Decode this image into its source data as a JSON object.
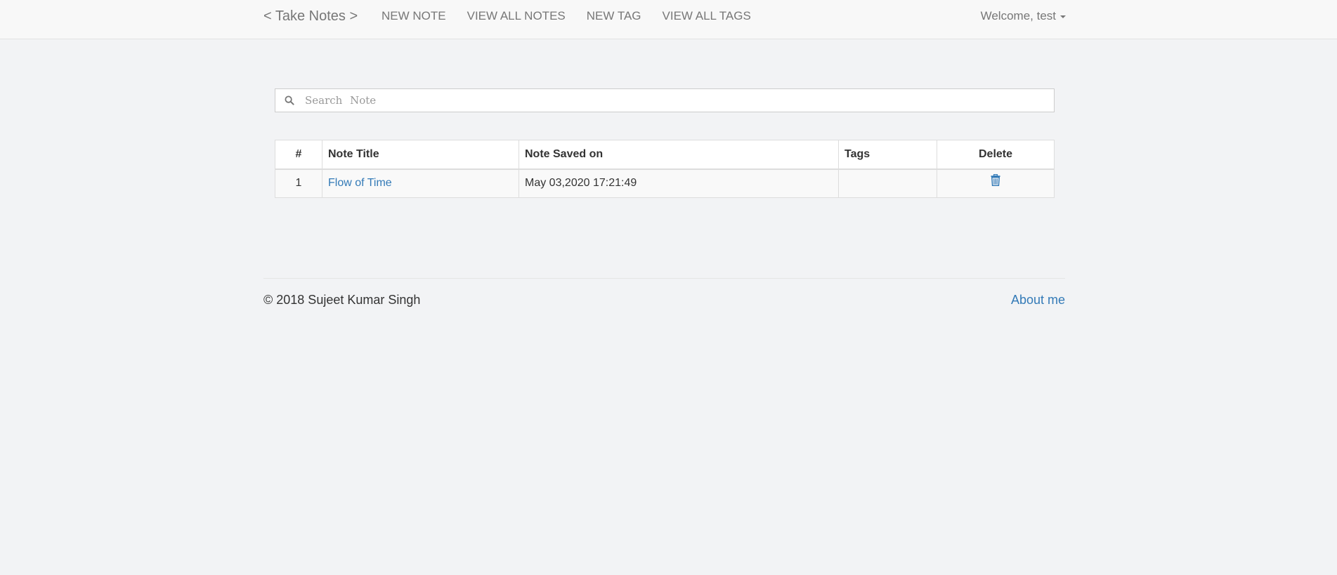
{
  "navbar": {
    "brand": "< Take Notes >",
    "links": [
      {
        "label": "NEW NOTE"
      },
      {
        "label": "VIEW ALL NOTES"
      },
      {
        "label": "NEW TAG"
      },
      {
        "label": "VIEW ALL TAGS"
      }
    ],
    "user_menu_label": "Welcome, test",
    "user_menu_icon": "caret-down-icon"
  },
  "search": {
    "placeholder": "Search Note",
    "value": "",
    "icon": "search-icon"
  },
  "table": {
    "headers": {
      "index": "#",
      "title": "Note Title",
      "saved_on": "Note Saved on",
      "tags": "Tags",
      "delete": "Delete"
    },
    "rows": [
      {
        "index": "1",
        "title": "Flow of Time",
        "saved_on": "May 03,2020 17:21:49",
        "tags": "",
        "delete_icon": "trash-icon"
      }
    ]
  },
  "footer": {
    "copyright": "© 2018 Sujeet Kumar Singh",
    "about_label": "About me"
  },
  "colors": {
    "link": "#337ab7",
    "nav_text": "#777777",
    "navbar_bg": "#f8f8f8",
    "page_bg": "#f2f3f5"
  }
}
